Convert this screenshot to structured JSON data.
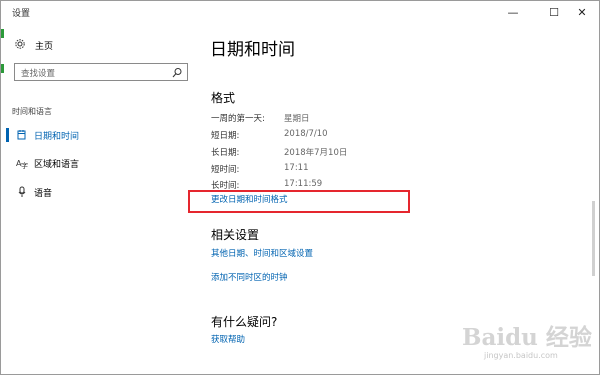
{
  "window": {
    "title": "设置",
    "minimize_glyph": "—",
    "maximize_glyph": "☐",
    "close_glyph": "✕"
  },
  "sidebar": {
    "home_label": "主页",
    "search_placeholder": "查找设置",
    "group_label": "时间和语言",
    "items": [
      {
        "label": "日期和时间",
        "icon": "calendar-clock-icon",
        "active": true
      },
      {
        "label": "区域和语言",
        "icon": "region-language-icon",
        "active": false
      },
      {
        "label": "语音",
        "icon": "microphone-icon",
        "active": false
      }
    ]
  },
  "main": {
    "page_title": "日期和时间",
    "format": {
      "title": "格式",
      "rows": [
        {
          "key": "一周的第一天:",
          "value": "星期日"
        },
        {
          "key": "短日期:",
          "value": "2018/7/10"
        },
        {
          "key": "长日期:",
          "value": "2018年7月10日"
        },
        {
          "key": "短时间:",
          "value": "17:11"
        },
        {
          "key": "长时间:",
          "value": "17:11:59"
        }
      ],
      "change_link": "更改日期和时间格式"
    },
    "related": {
      "title": "相关设置",
      "links": [
        "其他日期、时间和区域设置",
        "添加不同时区的时钟"
      ]
    },
    "help": {
      "title": "有什么疑问?",
      "link": "获取帮助"
    }
  },
  "watermark": {
    "main": "Baidu 经验",
    "sub": "jingyan.baidu.com"
  },
  "colors": {
    "accent": "#0063b1",
    "highlight_box": "#e5262e"
  }
}
